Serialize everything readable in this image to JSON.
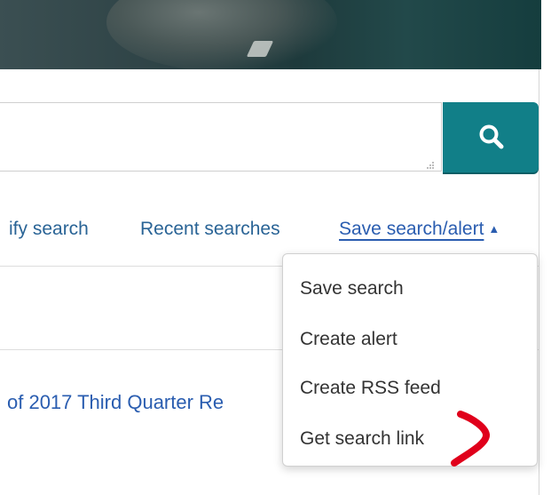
{
  "search": {
    "query_value": "",
    "button_icon": "search-icon"
  },
  "links": {
    "modify_search": "ify search",
    "recent_searches": "Recent searches",
    "save_search_alert": "Save search/alert",
    "caret": "▲"
  },
  "dropdown": {
    "items": [
      {
        "label": "Save search"
      },
      {
        "label": "Create alert"
      },
      {
        "label": "Create RSS feed"
      },
      {
        "label": "Get search link"
      }
    ]
  },
  "results": {
    "first_title": "of 2017 Third Quarter Re"
  },
  "colors": {
    "accent": "#117f88",
    "link": "#2a6496",
    "annotation": "#e0001b"
  }
}
